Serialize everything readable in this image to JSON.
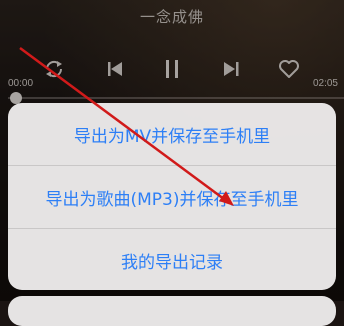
{
  "player": {
    "song_title": "一念成佛",
    "time_elapsed": "00:00",
    "time_total": "02:05",
    "progress": 0.0
  },
  "icons": {
    "repeat": "repeat-icon",
    "previous": "previous-track-icon",
    "pause": "pause-icon",
    "next": "next-track-icon",
    "favorite": "heart-icon"
  },
  "action_sheet": {
    "items": [
      {
        "label": "导出为MV并保存至手机里"
      },
      {
        "label": "导出为歌曲(MP3)并保存至手机里"
      },
      {
        "label": "我的导出记录"
      }
    ]
  },
  "colors": {
    "action_text": "#2d7ff6",
    "annotation_arrow": "#d11a1a"
  }
}
